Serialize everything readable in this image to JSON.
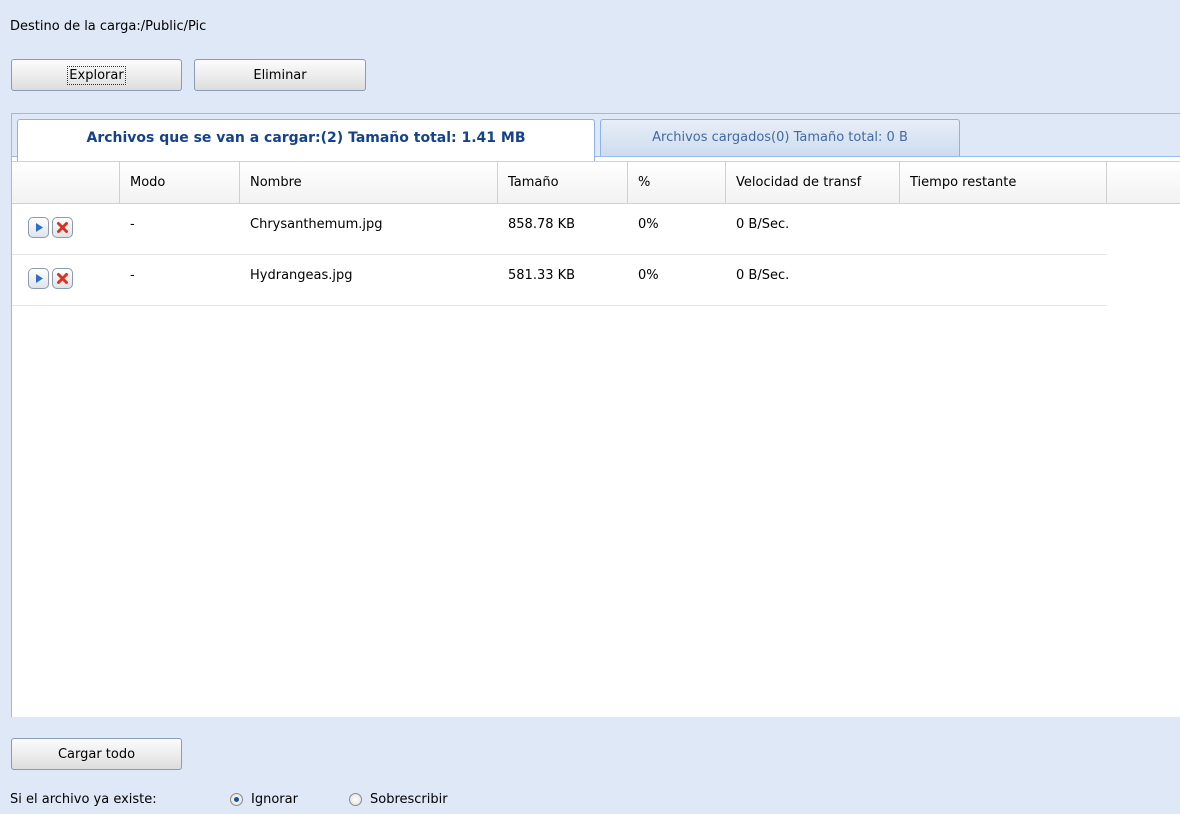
{
  "destination": "Destino de la carga:/Public/Pic",
  "toolbar": {
    "browse_label": "Explorar",
    "delete_label": "Eliminar"
  },
  "tabs": [
    {
      "label": "Archivos que se van a cargar:(2) Tamaño total: 1.41 MB",
      "active": true
    },
    {
      "label": "Archivos cargados(0) Tamaño total: 0 B",
      "active": false
    }
  ],
  "grid": {
    "columns": [
      "",
      "Modo",
      "Nombre",
      "Tamaño",
      "%",
      "Velocidad de transf",
      "Tiempo restante"
    ],
    "rows": [
      {
        "mode": "-",
        "name": "Chrysanthemum.jpg",
        "size": "858.78 KB",
        "percent": "0%",
        "speed": "0 B/Sec.",
        "remaining": ""
      },
      {
        "mode": "-",
        "name": "Hydrangeas.jpg",
        "size": "581.33 KB",
        "percent": "0%",
        "speed": "0 B/Sec.",
        "remaining": ""
      }
    ]
  },
  "upload_all_label": "Cargar todo",
  "exists_label": "Si el archivo ya existe:",
  "options": [
    {
      "label": "Ignorar",
      "selected": true
    },
    {
      "label": "Sobrescribir",
      "selected": false
    }
  ],
  "colors": {
    "background": "#dfe8f6",
    "active_tab_text": "#15428b",
    "inactive_tab_text": "#416aa3",
    "play_icon": "#2a6fc9",
    "cancel_icon": "#d9331f"
  }
}
